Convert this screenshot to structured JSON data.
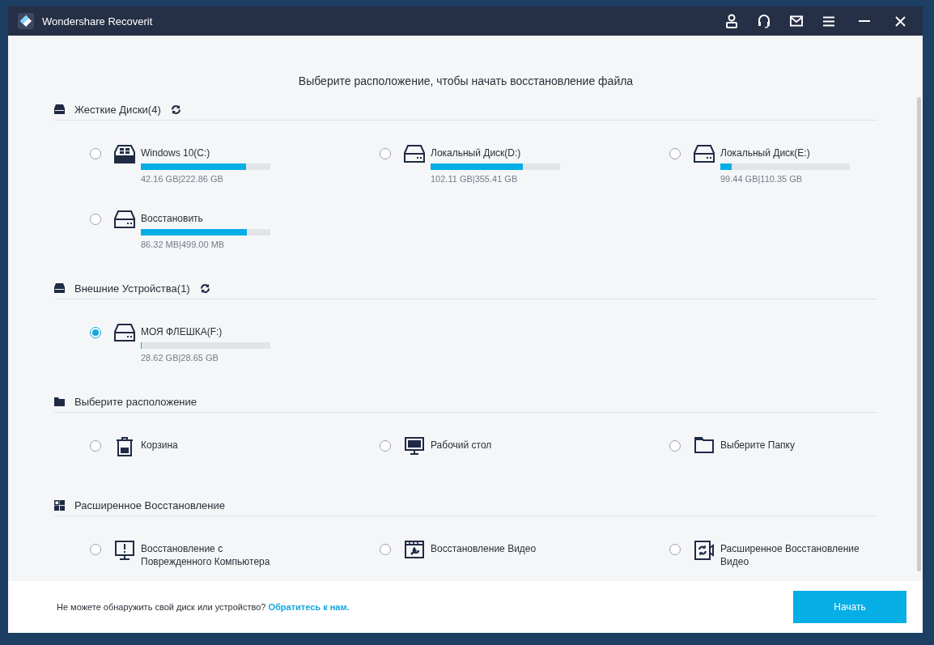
{
  "window": {
    "title": "Wondershare Recoverit"
  },
  "heading": "Выберите расположение, чтобы начать восстановление файла",
  "sections": [
    {
      "kind": "disk",
      "title": "Жесткие Диски(4)",
      "refreshable": true,
      "items": [
        {
          "kind": "system-drive",
          "name": "Windows 10(C:)",
          "level": 0.81,
          "usage": "42.16 GB|222.86 GB",
          "selected": false
        },
        {
          "kind": "drive",
          "name": "Локальный Диск(D:)",
          "level": 0.71,
          "usage": "102.11 GB|355.41 GB",
          "selected": false
        },
        {
          "kind": "drive",
          "name": "Локальный Диск(E:)",
          "level": 0.09,
          "usage": "99.44 GB|110.35 GB",
          "selected": false
        },
        {
          "kind": "drive",
          "name": "Восстановить",
          "level": 0.82,
          "usage": "86.32 MB|499.00 MB",
          "selected": false
        }
      ]
    },
    {
      "kind": "disk",
      "title": "Внешние Устройства(1)",
      "refreshable": true,
      "items": [
        {
          "kind": "drive",
          "name": "МОЯ ФЛЕШКА(F:)",
          "level": 0.001,
          "usage": "28.62 GB|28.65 GB",
          "selected": true
        }
      ]
    },
    {
      "kind": "location",
      "title": "Выберите расположение",
      "refreshable": false,
      "items": [
        {
          "kind": "trash",
          "name": "Корзина",
          "selected": false
        },
        {
          "kind": "desktop",
          "name": "Рабочий стол",
          "selected": false
        },
        {
          "kind": "folder",
          "name": "Выберите Папку",
          "selected": false
        }
      ]
    },
    {
      "kind": "advanced",
      "title": "Расширенное Восстановление",
      "refreshable": false,
      "items": [
        {
          "kind": "crash",
          "name": "Восстановление с Поврежденного Компьютера",
          "selected": false
        },
        {
          "kind": "video-repair",
          "name": "Восстановление Видео",
          "selected": false
        },
        {
          "kind": "advanced-video",
          "name": "Расширенное Восстановление Видео",
          "selected": false
        }
      ]
    }
  ],
  "footer": {
    "text": "Не можете обнаружить свой диск или устройство?",
    "link": "Обратитесь к нам.",
    "button": "Начать"
  }
}
